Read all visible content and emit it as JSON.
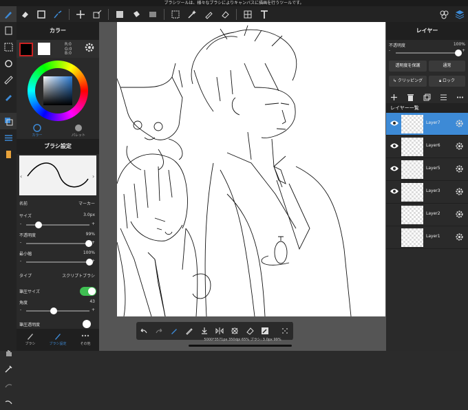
{
  "status_hint": "ブラシツールは、様々なブラシによりキャンバスに描画を行うツールです。",
  "color_panel": {
    "title": "カラー",
    "rgb": [
      "R:0",
      "G:0",
      "B:0"
    ],
    "tabs": [
      "カラー",
      "パレット"
    ],
    "primary_color": "#000000",
    "secondary_color": "#ffffff"
  },
  "brush_panel": {
    "title": "ブラシ設定",
    "name_label": "名前",
    "name_value": "マーカー",
    "size_label": "サイズ",
    "size_value": "3.0px",
    "size_level": 0.2,
    "opacity_label": "不透明度",
    "opacity_value": "99%",
    "opacity_level": 0.99,
    "min_width_label": "最小幅",
    "min_width_value": "100%",
    "min_width_level": 1.0,
    "type_label": "タイプ",
    "type_value": "スクリプトブラシ",
    "pressure_size_label": "筆圧サイズ",
    "pressure_size_on": true,
    "angle_label": "角度",
    "angle_value": "43",
    "angle_level": 0.43,
    "pressure_opacity_label": "筆圧透明度"
  },
  "bottom_tabs": [
    "ブラシ",
    "ブラシ設定",
    "その他"
  ],
  "canvas_status": "5000*3571px 350dpi 65% ブラシ: 3.0px 99%",
  "layer_panel": {
    "title": "レイヤー",
    "opacity_label": "不透明度",
    "opacity_value": "100%",
    "opacity_level": 1.0,
    "protect_alpha": "透明度を保護",
    "blend_mode": "通常",
    "clipping": "クリッピング",
    "lock": "ロック",
    "list_title": "レイヤー一覧",
    "layers": [
      {
        "name": "Layer7",
        "selected": true,
        "visible": true
      },
      {
        "name": "Layer6",
        "selected": false,
        "visible": true
      },
      {
        "name": "Layer5",
        "selected": false,
        "visible": true
      },
      {
        "name": "Layer3",
        "selected": false,
        "visible": true
      },
      {
        "name": "Layer2",
        "selected": false,
        "visible": false
      },
      {
        "name": "Layer1",
        "selected": false,
        "visible": false
      }
    ]
  },
  "accent_color": "#3d8ad6"
}
